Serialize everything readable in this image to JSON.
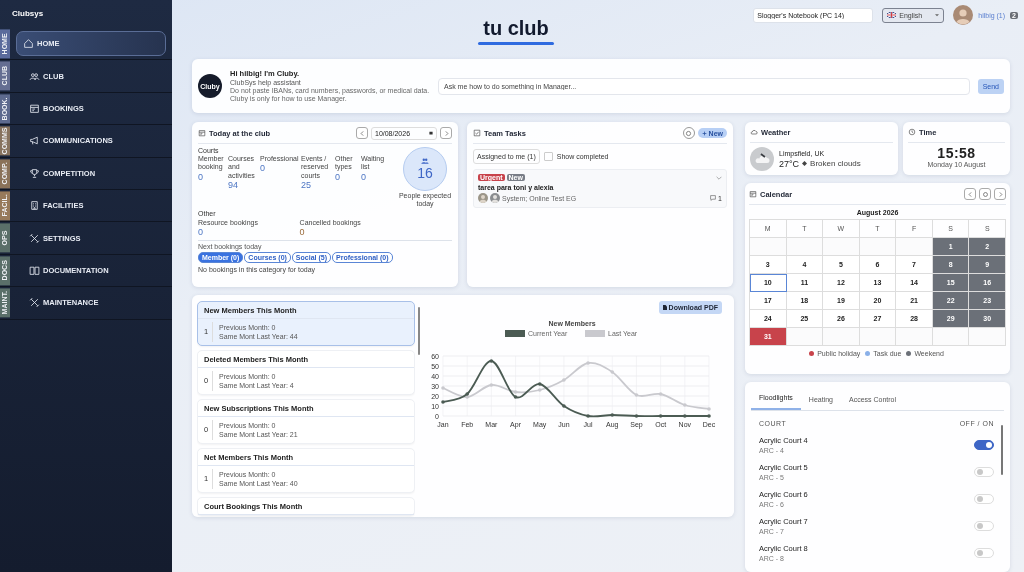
{
  "sidebar": {
    "brand": "Clubsys",
    "items": [
      {
        "label": "HOME",
        "tab": "HOME",
        "color": "#5b6b9c",
        "selected": true
      },
      {
        "label": "CLUB",
        "tab": "CLUB",
        "color": "#656e92",
        "selected": false
      },
      {
        "label": "BOOKINGS",
        "tab": "BOOK.",
        "color": "#5d6a8e",
        "selected": false
      },
      {
        "label": "COMMUNICATIONS",
        "tab": "COMMS",
        "color": "#87735f",
        "selected": false
      },
      {
        "label": "COMPETITION",
        "tab": "COMP.",
        "color": "#8a7259",
        "selected": false
      },
      {
        "label": "FACILITIES",
        "tab": "FACIL.",
        "color": "#977a5b",
        "selected": false
      },
      {
        "label": "SETTINGS",
        "tab": "OPS",
        "color": "#5a6f69",
        "selected": false
      },
      {
        "label": "DOCUMENTATION",
        "tab": "DOCS",
        "color": "#5a6f69",
        "selected": false
      },
      {
        "label": "MAINTENANCE",
        "tab": "MAINT.",
        "color": "#5a6f69",
        "selected": false
      }
    ]
  },
  "header": {
    "title": "tu club",
    "workstation": "Slogger's Notebook (PC 14)",
    "language": "English",
    "user": "hilbig (1)",
    "badge": "2"
  },
  "assistant": {
    "avatar": "Cluby",
    "greeting": "Hi hilbig! I'm Cluby.",
    "subtitle": "ClubSys help assistant",
    "warning": "Do not paste IBANs, card numbers, passwords, or medical data. Cluby is only for how to use Manager.",
    "placeholder": "Ask me how to do something in Manager...",
    "send": "Send"
  },
  "today": {
    "title": "Today at the club",
    "date": "10/08/2026",
    "courts_label": "Courts",
    "courts": [
      {
        "label": "Member booking",
        "value": "0"
      },
      {
        "label": "Courses and activities",
        "value": "94"
      },
      {
        "label": "Professional",
        "value": "0"
      },
      {
        "label": "Events / reserved courts",
        "value": "25"
      },
      {
        "label": "Other types",
        "value": "0"
      },
      {
        "label": "Waiting list",
        "value": "0"
      }
    ],
    "expected": {
      "value": "16",
      "label": "People expected today"
    },
    "other_label": "Other",
    "other": [
      {
        "label": "Resource bookings",
        "value": "0",
        "kind": "normal"
      },
      {
        "label": "Cancelled bookings",
        "value": "0",
        "kind": "cancelled"
      }
    ],
    "next_label": "Next bookings today",
    "filters": [
      {
        "label": "Member (0)",
        "selected": true
      },
      {
        "label": "Courses (0)",
        "selected": false
      },
      {
        "label": "Social (5)",
        "selected": false
      },
      {
        "label": "Professional (0)",
        "selected": false
      }
    ],
    "empty": "No bookings in this category for today"
  },
  "tasks": {
    "title": "Team Tasks",
    "new": "New",
    "filter": "Assigned to me (1)",
    "show_completed": {
      "label": "Show completed",
      "checked": false
    },
    "items": [
      {
        "tags": [
          {
            "label": "Urgent",
            "color": "#c8434b"
          },
          {
            "label": "New",
            "color": "#787d86"
          }
        ],
        "title": "tarea para toni y alexia",
        "assignees": "System; Online Test EG",
        "comments": "1"
      }
    ]
  },
  "weather": {
    "title": "Weather",
    "location": "Limpsfield, UK",
    "temperature": "27°C",
    "condition": "Broken clouds"
  },
  "time": {
    "title": "Time",
    "clock": "15:58",
    "date": "Monday 10 August"
  },
  "calendar": {
    "title": "Calendar",
    "month": "August 2026",
    "weekdays": [
      "M",
      "T",
      "W",
      "T",
      "F",
      "S",
      "S"
    ],
    "weeks": [
      [
        {
          "kind": "empty"
        },
        {
          "kind": "empty"
        },
        {
          "kind": "empty"
        },
        {
          "kind": "empty"
        },
        {
          "kind": "empty"
        },
        {
          "day": "1",
          "kind": "weekend"
        },
        {
          "day": "2",
          "kind": "weekend"
        }
      ],
      [
        {
          "day": "3",
          "kind": "plain"
        },
        {
          "day": "4",
          "kind": "plain"
        },
        {
          "day": "5",
          "kind": "plain"
        },
        {
          "day": "6",
          "kind": "plain"
        },
        {
          "day": "7",
          "kind": "plain"
        },
        {
          "day": "8",
          "kind": "weekend"
        },
        {
          "day": "9",
          "kind": "weekend"
        }
      ],
      [
        {
          "day": "10",
          "kind": "today"
        },
        {
          "day": "11",
          "kind": "plain"
        },
        {
          "day": "12",
          "kind": "plain"
        },
        {
          "day": "13",
          "kind": "plain"
        },
        {
          "day": "14",
          "kind": "plain"
        },
        {
          "day": "15",
          "kind": "weekend"
        },
        {
          "day": "16",
          "kind": "weekend"
        }
      ],
      [
        {
          "day": "17",
          "kind": "plain"
        },
        {
          "day": "18",
          "kind": "plain"
        },
        {
          "day": "19",
          "kind": "plain"
        },
        {
          "day": "20",
          "kind": "plain"
        },
        {
          "day": "21",
          "kind": "plain"
        },
        {
          "day": "22",
          "kind": "weekend"
        },
        {
          "day": "23",
          "kind": "weekend"
        }
      ],
      [
        {
          "day": "24",
          "kind": "plain"
        },
        {
          "day": "25",
          "kind": "plain"
        },
        {
          "day": "26",
          "kind": "plain"
        },
        {
          "day": "27",
          "kind": "plain"
        },
        {
          "day": "28",
          "kind": "plain"
        },
        {
          "day": "29",
          "kind": "weekend"
        },
        {
          "day": "30",
          "kind": "weekend"
        }
      ],
      [
        {
          "day": "31",
          "kind": "holiday"
        },
        {
          "kind": "empty"
        },
        {
          "kind": "empty"
        },
        {
          "kind": "empty"
        },
        {
          "kind": "empty"
        },
        {
          "kind": "empty"
        },
        {
          "kind": "empty"
        }
      ]
    ],
    "legend": [
      {
        "label": "Public holiday",
        "color": "#c8434b"
      },
      {
        "label": "Task due",
        "color": "#8ab0e8"
      },
      {
        "label": "Weekend",
        "color": "#6b7078"
      }
    ]
  },
  "stats": {
    "items": [
      {
        "title": "New Members This Month",
        "value": "1",
        "previous": "Previous Month: 0",
        "last_year": "Same Mont Last Year: 44",
        "selected": true
      },
      {
        "title": "Deleted Members This Month",
        "value": "0",
        "previous": "Previous Month: 0",
        "last_year": "Same Mont Last Year: 4",
        "selected": false
      },
      {
        "title": "New Subscriptions This Month",
        "value": "0",
        "previous": "Previous Month: 0",
        "last_year": "Same Mont Last Year: 21",
        "selected": false
      },
      {
        "title": "Net Members This Month",
        "value": "1",
        "previous": "Previous Month: 0",
        "last_year": "Same Mont Last Year: 40",
        "selected": false
      },
      {
        "title": "Court Bookings This Month",
        "selected": false
      }
    ],
    "download": "Download PDF",
    "chart_data": {
      "type": "line",
      "title": "New Members",
      "categories": [
        "Jan",
        "Feb",
        "Mar",
        "Apr",
        "May",
        "Jun",
        "Jul",
        "Aug",
        "Sep",
        "Oct",
        "Nov",
        "Dec"
      ],
      "series": [
        {
          "name": "Current Year",
          "color": "#4b5b53",
          "values": [
            14,
            22,
            55,
            19,
            32,
            10,
            0,
            1,
            0,
            0,
            0,
            0
          ]
        },
        {
          "name": "Last Year",
          "color": "#c9c9ce",
          "values": [
            28,
            19,
            31,
            24,
            26,
            36,
            53,
            44,
            21,
            22,
            11,
            7
          ]
        }
      ],
      "ylim": [
        0,
        60
      ],
      "yticks": [
        0,
        10,
        20,
        30,
        40,
        50,
        60
      ],
      "grid": true,
      "legend": true
    }
  },
  "facilities": {
    "tabs": [
      {
        "label": "Floodlights",
        "selected": true
      },
      {
        "label": "Heating",
        "selected": false
      },
      {
        "label": "Access Control",
        "selected": false
      }
    ],
    "columns": [
      "COURT",
      "OFF / ON"
    ],
    "rows": [
      {
        "name": "Acrylic Court 4",
        "code": "ARC - 4",
        "on": true
      },
      {
        "name": "Acrylic Court 5",
        "code": "ARC - 5",
        "on": false
      },
      {
        "name": "Acrylic Court 6",
        "code": "ARC - 6",
        "on": false
      },
      {
        "name": "Acrylic Court 7",
        "code": "ARC - 7",
        "on": false
      },
      {
        "name": "Acrylic Court 8",
        "code": "ARC - 8",
        "on": false
      }
    ]
  }
}
